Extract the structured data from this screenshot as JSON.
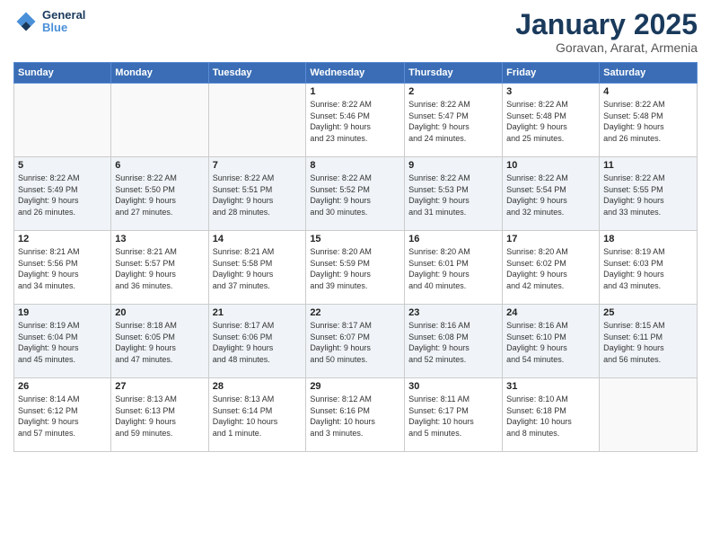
{
  "logo": {
    "line1": "General",
    "line2": "Blue"
  },
  "title": "January 2025",
  "location": "Goravan, Ararat, Armenia",
  "weekdays": [
    "Sunday",
    "Monday",
    "Tuesday",
    "Wednesday",
    "Thursday",
    "Friday",
    "Saturday"
  ],
  "weeks": [
    [
      {
        "day": "",
        "info": ""
      },
      {
        "day": "",
        "info": ""
      },
      {
        "day": "",
        "info": ""
      },
      {
        "day": "1",
        "info": "Sunrise: 8:22 AM\nSunset: 5:46 PM\nDaylight: 9 hours\nand 23 minutes."
      },
      {
        "day": "2",
        "info": "Sunrise: 8:22 AM\nSunset: 5:47 PM\nDaylight: 9 hours\nand 24 minutes."
      },
      {
        "day": "3",
        "info": "Sunrise: 8:22 AM\nSunset: 5:48 PM\nDaylight: 9 hours\nand 25 minutes."
      },
      {
        "day": "4",
        "info": "Sunrise: 8:22 AM\nSunset: 5:48 PM\nDaylight: 9 hours\nand 26 minutes."
      }
    ],
    [
      {
        "day": "5",
        "info": "Sunrise: 8:22 AM\nSunset: 5:49 PM\nDaylight: 9 hours\nand 26 minutes."
      },
      {
        "day": "6",
        "info": "Sunrise: 8:22 AM\nSunset: 5:50 PM\nDaylight: 9 hours\nand 27 minutes."
      },
      {
        "day": "7",
        "info": "Sunrise: 8:22 AM\nSunset: 5:51 PM\nDaylight: 9 hours\nand 28 minutes."
      },
      {
        "day": "8",
        "info": "Sunrise: 8:22 AM\nSunset: 5:52 PM\nDaylight: 9 hours\nand 30 minutes."
      },
      {
        "day": "9",
        "info": "Sunrise: 8:22 AM\nSunset: 5:53 PM\nDaylight: 9 hours\nand 31 minutes."
      },
      {
        "day": "10",
        "info": "Sunrise: 8:22 AM\nSunset: 5:54 PM\nDaylight: 9 hours\nand 32 minutes."
      },
      {
        "day": "11",
        "info": "Sunrise: 8:22 AM\nSunset: 5:55 PM\nDaylight: 9 hours\nand 33 minutes."
      }
    ],
    [
      {
        "day": "12",
        "info": "Sunrise: 8:21 AM\nSunset: 5:56 PM\nDaylight: 9 hours\nand 34 minutes."
      },
      {
        "day": "13",
        "info": "Sunrise: 8:21 AM\nSunset: 5:57 PM\nDaylight: 9 hours\nand 36 minutes."
      },
      {
        "day": "14",
        "info": "Sunrise: 8:21 AM\nSunset: 5:58 PM\nDaylight: 9 hours\nand 37 minutes."
      },
      {
        "day": "15",
        "info": "Sunrise: 8:20 AM\nSunset: 5:59 PM\nDaylight: 9 hours\nand 39 minutes."
      },
      {
        "day": "16",
        "info": "Sunrise: 8:20 AM\nSunset: 6:01 PM\nDaylight: 9 hours\nand 40 minutes."
      },
      {
        "day": "17",
        "info": "Sunrise: 8:20 AM\nSunset: 6:02 PM\nDaylight: 9 hours\nand 42 minutes."
      },
      {
        "day": "18",
        "info": "Sunrise: 8:19 AM\nSunset: 6:03 PM\nDaylight: 9 hours\nand 43 minutes."
      }
    ],
    [
      {
        "day": "19",
        "info": "Sunrise: 8:19 AM\nSunset: 6:04 PM\nDaylight: 9 hours\nand 45 minutes."
      },
      {
        "day": "20",
        "info": "Sunrise: 8:18 AM\nSunset: 6:05 PM\nDaylight: 9 hours\nand 47 minutes."
      },
      {
        "day": "21",
        "info": "Sunrise: 8:17 AM\nSunset: 6:06 PM\nDaylight: 9 hours\nand 48 minutes."
      },
      {
        "day": "22",
        "info": "Sunrise: 8:17 AM\nSunset: 6:07 PM\nDaylight: 9 hours\nand 50 minutes."
      },
      {
        "day": "23",
        "info": "Sunrise: 8:16 AM\nSunset: 6:08 PM\nDaylight: 9 hours\nand 52 minutes."
      },
      {
        "day": "24",
        "info": "Sunrise: 8:16 AM\nSunset: 6:10 PM\nDaylight: 9 hours\nand 54 minutes."
      },
      {
        "day": "25",
        "info": "Sunrise: 8:15 AM\nSunset: 6:11 PM\nDaylight: 9 hours\nand 56 minutes."
      }
    ],
    [
      {
        "day": "26",
        "info": "Sunrise: 8:14 AM\nSunset: 6:12 PM\nDaylight: 9 hours\nand 57 minutes."
      },
      {
        "day": "27",
        "info": "Sunrise: 8:13 AM\nSunset: 6:13 PM\nDaylight: 9 hours\nand 59 minutes."
      },
      {
        "day": "28",
        "info": "Sunrise: 8:13 AM\nSunset: 6:14 PM\nDaylight: 10 hours\nand 1 minute."
      },
      {
        "day": "29",
        "info": "Sunrise: 8:12 AM\nSunset: 6:16 PM\nDaylight: 10 hours\nand 3 minutes."
      },
      {
        "day": "30",
        "info": "Sunrise: 8:11 AM\nSunset: 6:17 PM\nDaylight: 10 hours\nand 5 minutes."
      },
      {
        "day": "31",
        "info": "Sunrise: 8:10 AM\nSunset: 6:18 PM\nDaylight: 10 hours\nand 8 minutes."
      },
      {
        "day": "",
        "info": ""
      }
    ]
  ]
}
